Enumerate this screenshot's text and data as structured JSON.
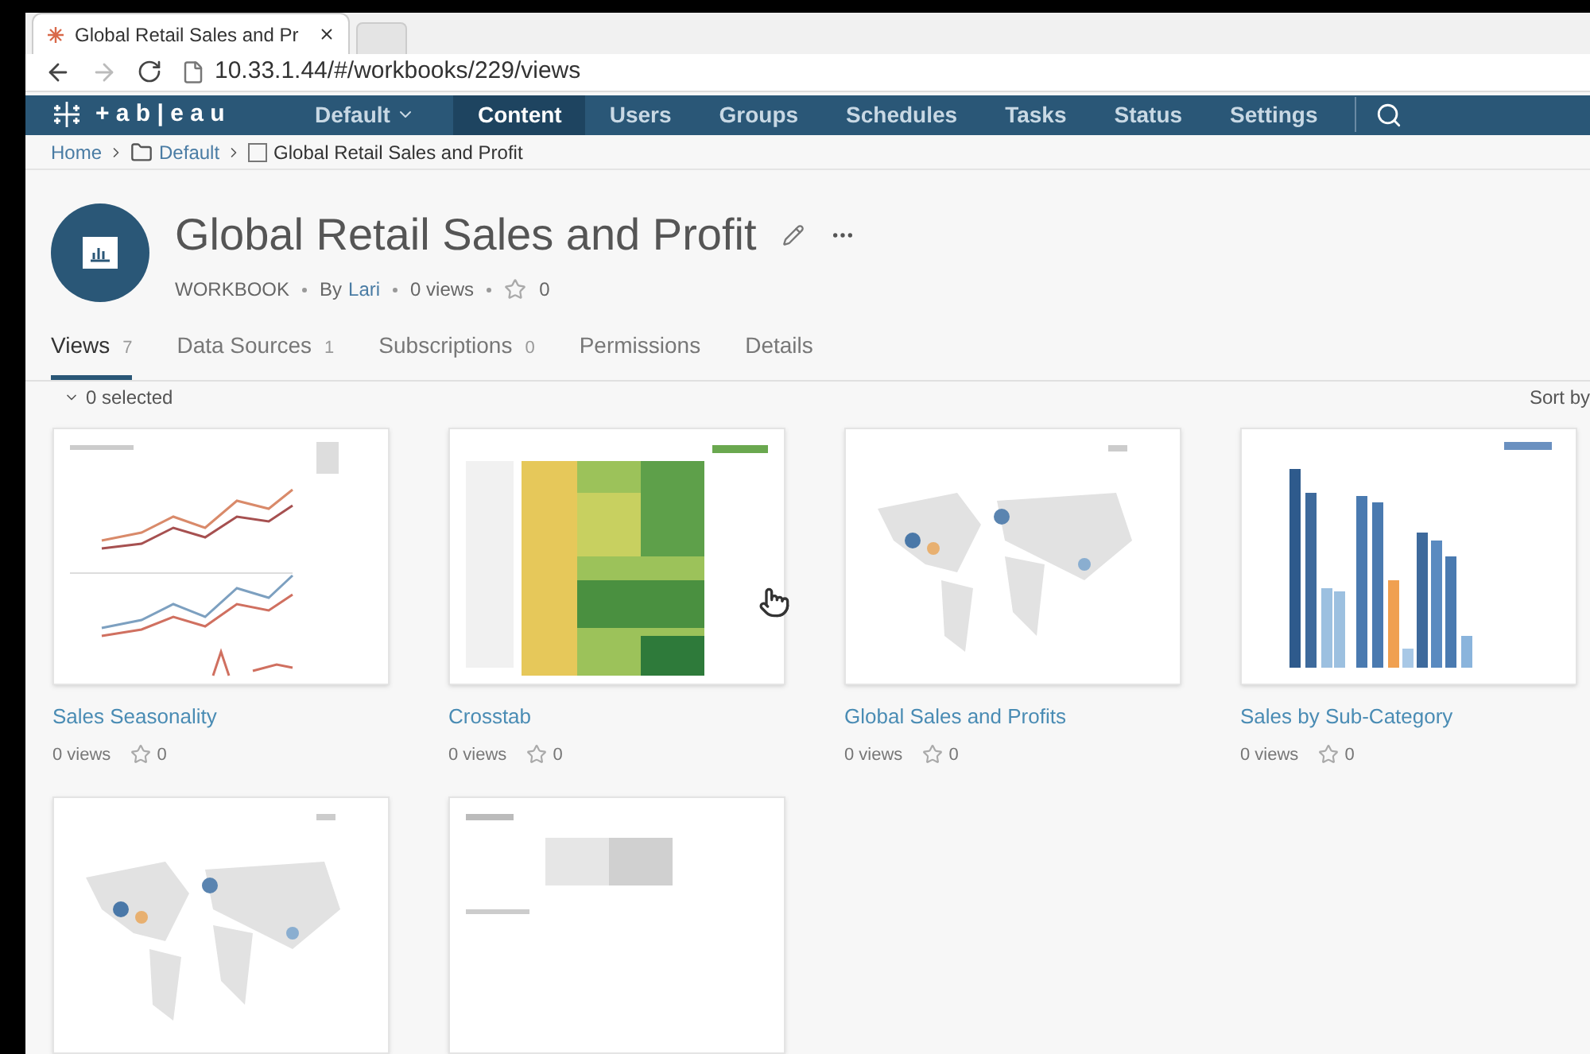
{
  "browser": {
    "tab_title": "Global Retail Sales and Pr",
    "url": "10.33.1.44/#/workbooks/229/views"
  },
  "nav": {
    "logo": "+ a b | e a u",
    "site": "Default",
    "items": [
      {
        "label": "Content",
        "selected": true
      },
      {
        "label": "Users",
        "selected": false
      },
      {
        "label": "Groups",
        "selected": false
      },
      {
        "label": "Schedules",
        "selected": false
      },
      {
        "label": "Tasks",
        "selected": false
      },
      {
        "label": "Status",
        "selected": false
      },
      {
        "label": "Settings",
        "selected": false
      }
    ]
  },
  "breadcrumb": [
    {
      "label": "Home",
      "kind": "link"
    },
    {
      "label": "Default",
      "kind": "folder"
    },
    {
      "label": "Global Retail Sales and Profit",
      "kind": "workbook"
    }
  ],
  "workbook": {
    "title": "Global Retail Sales and Profit",
    "type": "WORKBOOK",
    "by": "By",
    "author": "Lari",
    "views": "0 views",
    "favorites": "0"
  },
  "tabs": [
    {
      "label": "Views",
      "count": "7",
      "selected": true
    },
    {
      "label": "Data Sources",
      "count": "1",
      "selected": false
    },
    {
      "label": "Subscriptions",
      "count": "0",
      "selected": false
    },
    {
      "label": "Permissions",
      "selected": false
    },
    {
      "label": "Details",
      "selected": false
    }
  ],
  "selection": "0 selected",
  "sort": "Sort by",
  "views": [
    {
      "title": "Sales Seasonality",
      "views": "0 views",
      "favorites": "0",
      "kind": "lines"
    },
    {
      "title": "Crosstab",
      "views": "0 views",
      "favorites": "0",
      "kind": "heatmap"
    },
    {
      "title": "Global Sales and Profits",
      "views": "0 views",
      "favorites": "0",
      "kind": "map"
    },
    {
      "title": "Sales by Sub-Category",
      "views": "0 views",
      "favorites": "0",
      "kind": "bars"
    },
    {
      "kind": "map"
    },
    {
      "kind": "story"
    }
  ]
}
